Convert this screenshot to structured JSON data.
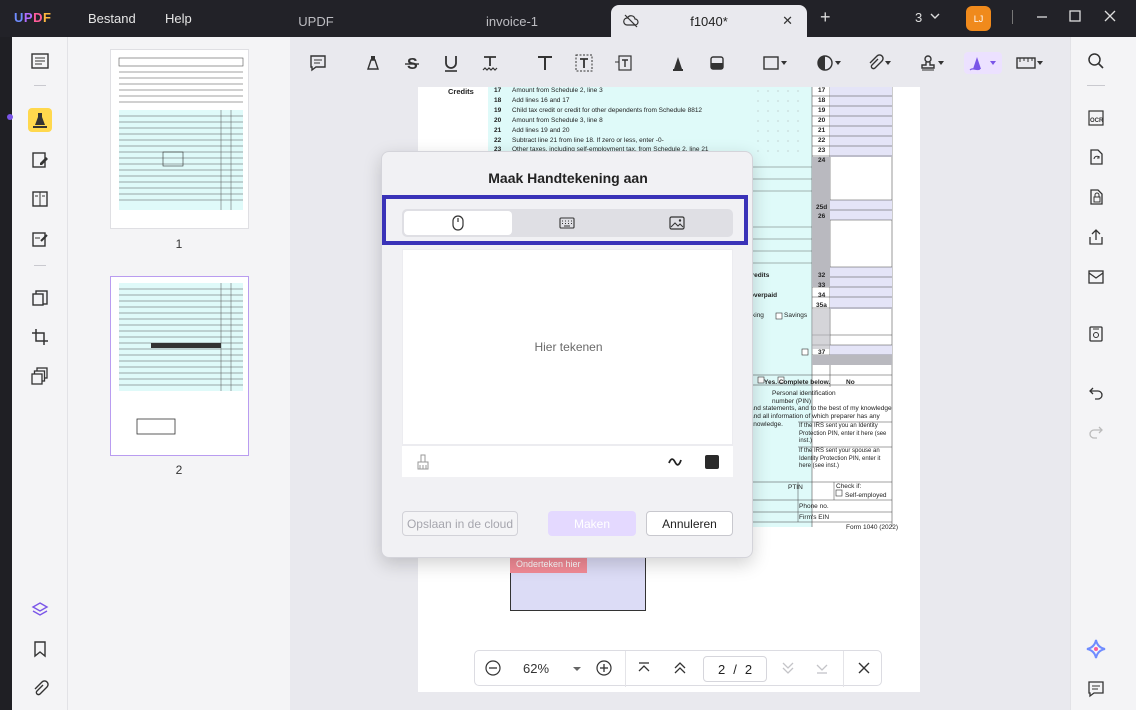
{
  "app": {
    "logo": "UPDF",
    "menu": [
      "Bestand",
      "Help"
    ],
    "tabs": [
      {
        "label": "UPDF"
      },
      {
        "label": "invoice-1"
      },
      {
        "label": "f1040*",
        "active": true
      }
    ],
    "tab_count": "3",
    "avatar_initial": "LJ"
  },
  "thumbnails": [
    {
      "page": "1"
    },
    {
      "page": "2",
      "selected": true
    }
  ],
  "document": {
    "credits_label": "Credits",
    "rows": [
      {
        "num": "17",
        "text": "Amount from Schedule 2, line 3"
      },
      {
        "num": "18",
        "text": "Add lines 16 and 17"
      },
      {
        "num": "19",
        "text": "Child tax credit or credit for other dependents from Schedule 8812"
      },
      {
        "num": "20",
        "text": "Amount from Schedule 3, line 8"
      },
      {
        "num": "21",
        "text": "Add lines 19 and 20"
      },
      {
        "num": "22",
        "text": "Subtract line 21 from line 18. If zero or less, enter -0-"
      },
      {
        "num": "23",
        "text": "Other taxes, including self-employment tax, from Schedule 2, line 21"
      }
    ],
    "right_numbers": [
      "17",
      "18",
      "19",
      "20",
      "21",
      "22",
      "23",
      "24",
      "25d",
      "26",
      "32",
      "33",
      "34",
      "35a",
      "37"
    ],
    "side_texts": {
      "credits_tail": "credits",
      "overpaid": "overpaid",
      "king": "king",
      "savings": "Savings",
      "yes_complete": "Yes. Complete below.",
      "no": "No",
      "pin_label": "Personal identification number (PIN)",
      "statement": "and statements, and to the best of my knowledge and all information of which preparer has any knowledge.",
      "irs_pin_you": "If the IRS sent you an Identity Protection PIN, enter it here (see inst.)",
      "irs_pin_spouse": "If the IRS sent your spouse an Identity Protection PIN, enter it here (see inst.)",
      "ptin": "PTIN",
      "check_if": "Check if:",
      "self_employed": "Self-employed",
      "phone": "Phone no.",
      "firm_ein": "Firm's EIN",
      "form_footer": "Form 1040 (2022)"
    },
    "sign_here_tag": "Onderteken hier"
  },
  "bottom_bar": {
    "zoom": "62%",
    "current_page": "2",
    "separator": "/",
    "total_pages": "2"
  },
  "dialog": {
    "title": "Maak Handtekening aan",
    "modes": [
      "mouse-icon",
      "keyboard-icon",
      "image-icon"
    ],
    "placeholder": "Hier tekenen",
    "buttons": {
      "save_cloud": "Opslaan in de cloud",
      "make": "Maken",
      "cancel": "Annuleren"
    }
  },
  "colors": {
    "accent_purple": "#b99cf0",
    "highlight_outline": "#3a33b8",
    "form_cyan": "#dffaf9",
    "sign_tag": "#f28b96"
  }
}
